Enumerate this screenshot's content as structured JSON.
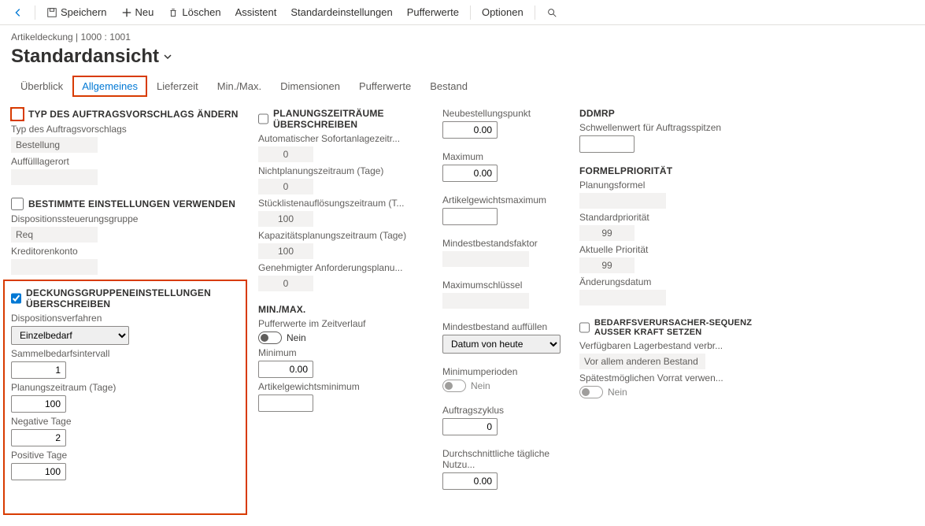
{
  "toolbar": {
    "save": "Speichern",
    "new": "Neu",
    "delete": "Löschen",
    "assistant": "Assistent",
    "defaults": "Standardeinstellungen",
    "buffer": "Pufferwerte",
    "options": "Optionen"
  },
  "breadcrumb": "Artikeldeckung   |   1000 : 1001",
  "title": "Standardansicht",
  "tabs": {
    "overview": "Überblick",
    "general": "Allgemeines",
    "leadtime": "Lieferzeit",
    "minmax": "Min./Max.",
    "dimensions": "Dimensionen",
    "buffer": "Pufferwerte",
    "inventory": "Bestand"
  },
  "col1": {
    "sec1_title": "TYP DES AUFTRAGSVORSCHLAGS ÄNDERN",
    "plannedOrderType_label": "Typ des Auftragsvorschlags",
    "plannedOrderType_value": "Bestellung",
    "fulfillWarehouse_label": "Auffülllagerort",
    "fulfillWarehouse_value": "",
    "sec2_title": "BESTIMMTE EINSTELLUNGEN VERWENDEN",
    "coverageGroup_label": "Dispositionssteuerungsgruppe",
    "coverageGroup_value": "Req",
    "vendorAccount_label": "Kreditorenkonto",
    "vendorAccount_value": "",
    "sec3_title": "DECKUNGSGRUPPENEINSTELLUNGEN ÜBERSCHREIBEN",
    "coverageCode_label": "Dispositionsverfahren",
    "coverageCode_value": "Einzelbedarf",
    "period_label": "Sammelbedarfsintervall",
    "period_value": "1",
    "timeFence_label": "Planungszeitraum (Tage)",
    "timeFence_value": "100",
    "negativeDays_label": "Negative Tage",
    "negativeDays_value": "2",
    "positiveDays_label": "Positive Tage",
    "positiveDays_value": "100"
  },
  "col2": {
    "sec1_title": "PLANUNGSZEITRÄUME ÜBERSCHREIBEN",
    "autoFirm_label": "Automatischer Sofortanlagezeitr...",
    "autoFirm_value": "0",
    "freeze_label": "Nichtplanungszeitraum (Tage)",
    "freeze_value": "0",
    "bomExplosion_label": "Stücklistenauflösungszeitraum (T...",
    "bomExplosion_value": "100",
    "capacity_label": "Kapazitätsplanungszeitraum (Tage)",
    "capacity_value": "100",
    "approvedReq_label": "Genehmigter Anforderungsplanu...",
    "approvedReq_value": "0",
    "sec2_title": "MIN./MAX.",
    "bufferTime_label": "Pufferwerte im Zeitverlauf",
    "bufferTime_value": "Nein",
    "minimum_label": "Minimum",
    "minimum_value": "0.00",
    "cwMin_label": "Artikelgewichtsminimum",
    "cwMin_value": ""
  },
  "col3": {
    "reorder_label": "Neubestellungspunkt",
    "reorder_value": "0.00",
    "maximum_label": "Maximum",
    "maximum_value": "0.00",
    "cwMax_label": "Artikelgewichtsmaximum",
    "cwMax_value": "",
    "minFactor_label": "Mindestbestandsfaktor",
    "minFactor_value": "",
    "maxKey_label": "Maximumschlüssel",
    "maxKey_value": "",
    "fulfillMin_label": "Mindestbestand auffüllen",
    "fulfillMin_value": "Datum von heute",
    "minPeriods_label": "Minimumperioden",
    "minPeriods_value": "Nein",
    "orderCycle_label": "Auftragszyklus",
    "orderCycle_value": "0",
    "adu_label": "Durchschnittliche tägliche Nutzu...",
    "adu_value": "0.00"
  },
  "col4": {
    "sec1_title": "DDMRP",
    "spike_label": "Schwellenwert für Auftragsspitzen",
    "spike_value": "",
    "sec2_title": "FORMELPRIORITÄT",
    "planFormula_label": "Planungsformel",
    "planFormula_value": "",
    "stdPriority_label": "Standardpriorität",
    "stdPriority_value": "99",
    "curPriority_label": "Aktuelle Priorität",
    "curPriority_value": "99",
    "changeDate_label": "Änderungsdatum",
    "changeDate_value": "",
    "sec3_title": "BEDARFSVERURSACHER-SEQUENZ AUSSER KRAFT SETZEN",
    "consumeOnHand_label": "Verfügbaren Lagerbestand verbr...",
    "consumeOnHand_value": "Vor allem anderen Bestand",
    "useLatest_label": "Spätestmöglichen Vorrat verwen...",
    "useLatest_value": "Nein"
  }
}
